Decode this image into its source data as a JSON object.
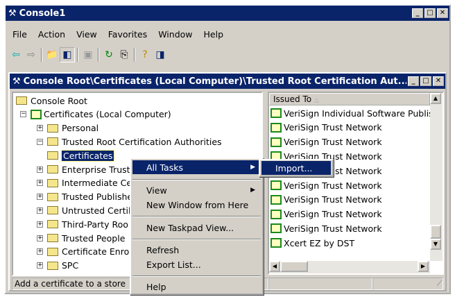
{
  "app": {
    "title": "Console1"
  },
  "menu": [
    "File",
    "Action",
    "View",
    "Favorites",
    "Window",
    "Help"
  ],
  "toolbar": [
    "back-icon",
    "forward-icon",
    "up-folder-icon",
    "show-hide-tree-icon",
    "paste-icon",
    "refresh-icon",
    "export-list-icon",
    "help-icon",
    "show-hide-action-pane-icon"
  ],
  "child": {
    "title": "Console Root\\Certificates (Local Computer)\\Trusted Root Certification Aut..."
  },
  "tree": [
    {
      "label": "Console Root",
      "level": 0
    },
    {
      "label": "Certificates (Local Computer)",
      "level": 1,
      "expander": "minus"
    },
    {
      "label": "Personal",
      "level": 2,
      "expander": "plus"
    },
    {
      "label": "Trusted Root Certification Authorities",
      "level": 2,
      "expander": "minus"
    },
    {
      "label": "Certificates",
      "level": 3,
      "selected": true
    },
    {
      "label": "Enterprise Trust",
      "level": 2,
      "expander": "plus"
    },
    {
      "label": "Intermediate Ce",
      "level": 2,
      "expander": "plus"
    },
    {
      "label": "Trusted Publishe",
      "level": 2,
      "expander": "plus"
    },
    {
      "label": "Untrusted Certil",
      "level": 2,
      "expander": "plus"
    },
    {
      "label": "Third-Party Roo",
      "level": 2,
      "expander": "plus"
    },
    {
      "label": "Trusted People",
      "level": 2,
      "expander": "plus"
    },
    {
      "label": "Certificate Enro",
      "level": 2,
      "expander": "plus"
    },
    {
      "label": "SPC",
      "level": 2,
      "expander": "plus"
    }
  ],
  "list": {
    "header": "Issued To",
    "rows": [
      "VeriSign Individual Software Publis.",
      "VeriSign Trust Network",
      "VeriSign Trust Network",
      "VeriSign Trust Network",
      "VeriSign Trust Network",
      "VeriSign Trust Network",
      "VeriSign Trust Network",
      "VeriSign Trust Network",
      "VeriSign Trust Network",
      "Xcert EZ by DST"
    ]
  },
  "context_menu": {
    "all_tasks": "All Tasks",
    "view": "View",
    "new_window": "New Window from Here",
    "new_taskpad": "New Taskpad View...",
    "refresh": "Refresh",
    "export": "Export List...",
    "help": "Help"
  },
  "submenu": {
    "import": "Import..."
  },
  "status": "Add a certificate to a store",
  "colors": {
    "titlebar": "#0a246a",
    "face": "#d4d0c8"
  }
}
